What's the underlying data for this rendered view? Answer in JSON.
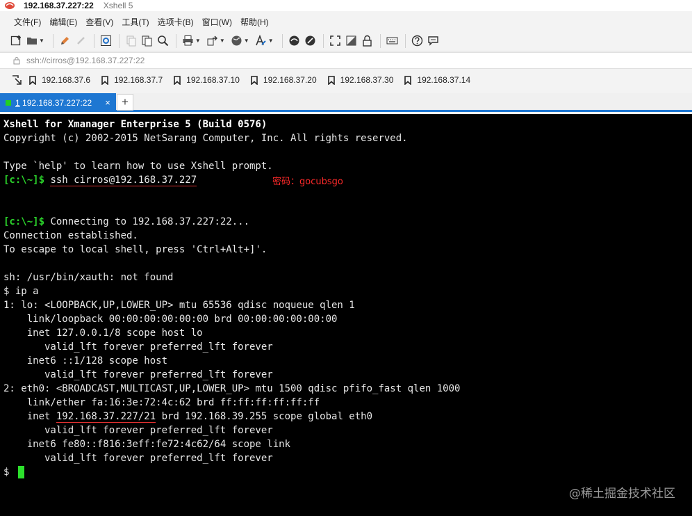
{
  "window": {
    "title": "192.168.37.227:22",
    "app_name": "Xshell 5"
  },
  "menu": [
    "文件(F)",
    "编辑(E)",
    "查看(V)",
    "工具(T)",
    "选项卡(B)",
    "窗口(W)",
    "帮助(H)"
  ],
  "address": {
    "value": "ssh://cirros@192.168.37.227:22"
  },
  "links": [
    "192.168.37.6",
    "192.168.37.7",
    "192.168.37.10",
    "192.168.37.20",
    "192.168.37.30",
    "192.168.37.14"
  ],
  "tabs": [
    {
      "index": "1",
      "label": "192.168.37.227:22",
      "close": "×"
    }
  ],
  "tab_add": "+",
  "terminal": {
    "banner1": "Xshell for Xmanager Enterprise 5 (Build 0576)",
    "banner2": "Copyright (c) 2002-2015 NetSarang Computer, Inc. All rights reserved.",
    "help": "Type `help' to learn how to use Xshell prompt.",
    "prompt": "[c:\\~]$",
    "ssh_cmd": "ssh cirros@192.168.37.227",
    "annotation": "密码：gocubsgo",
    "connecting": "Connecting to 192.168.37.227:22...",
    "established": "Connection established.",
    "escape": "To escape to local shell, press 'Ctrl+Alt+]'.",
    "xauth": "sh: /usr/bin/xauth: not found",
    "cmd_ip": "$ ip a",
    "lo1": "1: lo: <LOOPBACK,UP,LOWER_UP> mtu 65536 qdisc noqueue qlen 1",
    "lo2": "    link/loopback 00:00:00:00:00:00 brd 00:00:00:00:00:00",
    "lo3": "    inet 127.0.0.1/8 scope host lo",
    "lo4": "       valid_lft forever preferred_lft forever",
    "lo5": "    inet6 ::1/128 scope host",
    "lo6": "       valid_lft forever preferred_lft forever",
    "eth1": "2: eth0: <BROADCAST,MULTICAST,UP,LOWER_UP> mtu 1500 qdisc pfifo_fast qlen 1000",
    "eth2": "    link/ether fa:16:3e:72:4c:62 brd ff:ff:ff:ff:ff:ff",
    "eth3_pre": "    inet ",
    "eth3_ip": "192.168.37.227/21",
    "eth3_post": " brd 192.168.39.255 scope global eth0",
    "eth4": "       valid_lft forever preferred_lft forever",
    "eth5": "    inet6 fe80::f816:3eff:fe72:4c62/64 scope link",
    "eth6": "       valid_lft forever preferred_lft forever",
    "last_prompt": "$"
  },
  "watermark": "@稀土掘金技术社区"
}
